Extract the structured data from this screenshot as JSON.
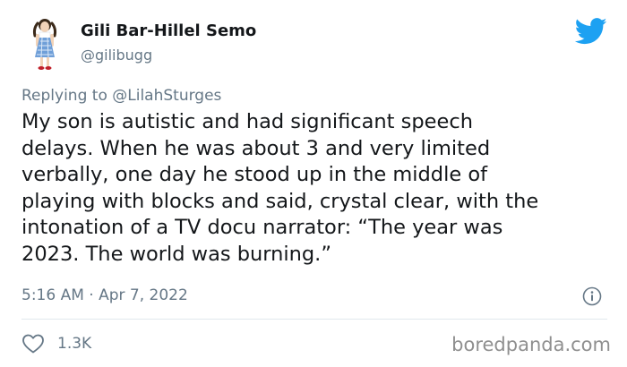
{
  "author": {
    "display_name": "Gili Bar-Hillel Semo",
    "handle": "@gilibugg",
    "avatar_icon": "avatar-dorothy-illustration"
  },
  "logo_icon": "twitter-bird-icon",
  "reply": {
    "prefix": "Replying to ",
    "mention": "@LilahSturges"
  },
  "body_lines": [
    "My son is autistic and had significant speech",
    "delays. When he was about 3 and very limited",
    "verbally, one day he stood up in the middle of",
    "playing with blocks and said, crystal clear, with the",
    "intonation of a TV docu narrator: “The year was",
    "2023. The world was burning.”"
  ],
  "timestamp": "5:16 AM · Apr 7, 2022",
  "info_icon": "info-icon",
  "likes": {
    "icon": "heart-icon",
    "count": "1.3K"
  },
  "watermark": "boredpanda.com",
  "colors": {
    "twitter_blue": "#1da1f2",
    "secondary_text": "#657786",
    "primary_text": "#14171a",
    "divider": "#e1e8ed"
  }
}
